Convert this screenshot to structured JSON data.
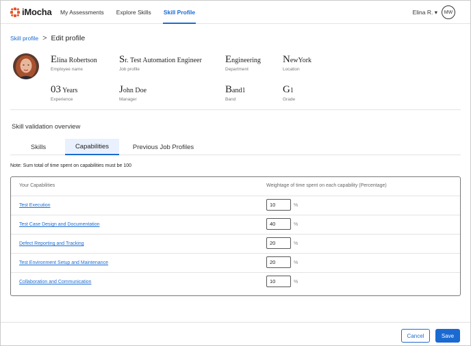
{
  "header": {
    "logo_text": "iMocha",
    "nav": [
      {
        "label": "My Assessments"
      },
      {
        "label": "Explore Skills"
      },
      {
        "label": "Skill Profile"
      }
    ],
    "user_name": "Elina R. ▾",
    "user_initials": "MW"
  },
  "breadcrumb": {
    "parent": "Skill profile",
    "separator": ">",
    "current": "Edit profile"
  },
  "profile": {
    "name": {
      "first": "E",
      "rest": "lina Robertson",
      "label": "Employee name"
    },
    "job": {
      "first": "S",
      "rest": "r. Test Automation Engineer",
      "label": "Job profile"
    },
    "department": {
      "first": "E",
      "rest": "ngineering",
      "label": "Department"
    },
    "location": {
      "first": "N",
      "rest": "ewYork",
      "label": "Location"
    },
    "experience": {
      "first": "03",
      "rest": " Years",
      "label": "Experience"
    },
    "manager": {
      "first": "J",
      "rest": "ohn Doe",
      "label": "Manager"
    },
    "band": {
      "first": "B",
      "rest": "and1",
      "label": "Band"
    },
    "grade": {
      "first": "G",
      "rest": "1",
      "label": "Grade"
    }
  },
  "validation": {
    "title": "Skill validation overview",
    "tabs": [
      {
        "label": "Skills"
      },
      {
        "label": "Capabilities"
      },
      {
        "label": "Previous Job Profiles"
      }
    ],
    "active_tab": "Capabilities",
    "note": "Note: Sum total of time spent on capabilities must be 100",
    "table": {
      "col_capabilities": "Your Capabilities",
      "col_weight": "Weightage of time spent on each capability (Percentage)",
      "rows": [
        {
          "name": "Test Execution",
          "value": "10",
          "unit": "%"
        },
        {
          "name": "Test Case Design and Documentation",
          "value": "40",
          "unit": "%"
        },
        {
          "name": "Defect Reporting and Tracking",
          "value": "20",
          "unit": "%"
        },
        {
          "name": "Test Environment Setup and Maintenance",
          "value": "20",
          "unit": "%"
        },
        {
          "name": "Collaboration and Communication",
          "value": "10",
          "unit": "%"
        }
      ]
    }
  },
  "footer": {
    "cancel_label": "Cancel",
    "save_label": "Save"
  },
  "colors": {
    "accent": "#1a6ad1",
    "logo_orange": "#e8562a"
  }
}
